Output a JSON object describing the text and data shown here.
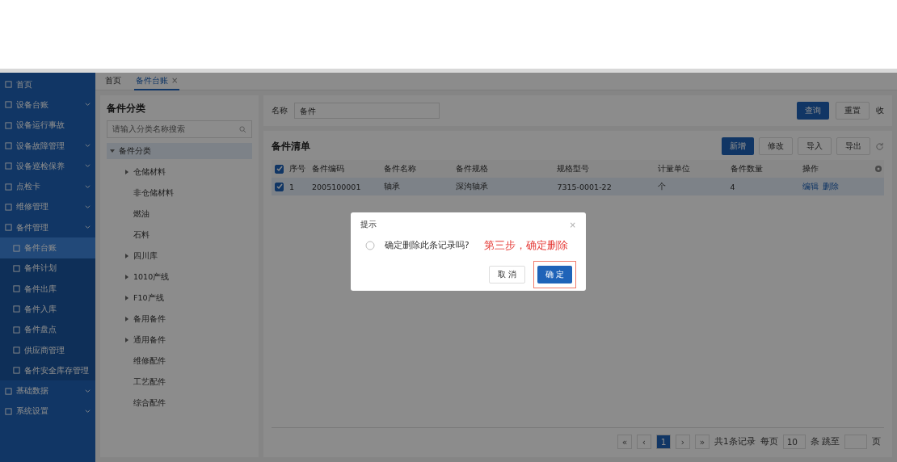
{
  "sidebar": {
    "items": [
      {
        "label": "首页",
        "expandable": false,
        "selected": false
      },
      {
        "label": "设备台账",
        "expandable": true,
        "selected": false
      },
      {
        "label": "设备运行事故",
        "expandable": false,
        "selected": false
      },
      {
        "label": "设备故障管理",
        "expandable": true,
        "selected": false
      },
      {
        "label": "设备巡检保养",
        "expandable": true,
        "selected": false
      },
      {
        "label": "点检卡",
        "expandable": true,
        "selected": false
      },
      {
        "label": "维修管理",
        "expandable": true,
        "selected": false
      },
      {
        "label": "备件管理",
        "expandable": true,
        "selected": false,
        "expanded": true,
        "children": [
          {
            "label": "备件台账",
            "selected": true
          },
          {
            "label": "备件计划",
            "selected": false
          },
          {
            "label": "备件出库",
            "selected": false
          },
          {
            "label": "备件入库",
            "selected": false
          },
          {
            "label": "备件盘点",
            "selected": false
          },
          {
            "label": "供应商管理",
            "selected": false
          },
          {
            "label": "备件安全库存管理",
            "selected": false
          }
        ]
      },
      {
        "label": "基础数据",
        "expandable": true,
        "selected": false
      },
      {
        "label": "系统设置",
        "expandable": true,
        "selected": false
      }
    ]
  },
  "tabs": [
    {
      "label": "首页",
      "selected": false
    },
    {
      "label": "备件台账",
      "selected": true,
      "close": "×"
    }
  ],
  "category_panel": {
    "title": "备件分类",
    "search": {
      "placeholder": "请输入分类名称搜索"
    },
    "tree": [
      {
        "label": "备件分类",
        "expandable": true,
        "expanded": true,
        "selected": true,
        "children": [
          {
            "label": "仓储材料",
            "expandable": true,
            "expanded": false,
            "selected": false
          },
          {
            "label": "非仓储材料",
            "expandable": false,
            "expanded": false,
            "selected": false
          },
          {
            "label": "燃油",
            "expandable": false,
            "expanded": false,
            "selected": false
          },
          {
            "label": "石料",
            "expandable": false,
            "expanded": false,
            "selected": false
          },
          {
            "label": "四川库",
            "expandable": true,
            "expanded": false,
            "selected": false
          },
          {
            "label": "1010产线",
            "expandable": true,
            "expanded": false,
            "selected": false
          },
          {
            "label": "F10产线",
            "expandable": true,
            "expanded": false,
            "selected": false
          },
          {
            "label": "备用备件",
            "expandable": true,
            "expanded": false,
            "selected": false
          },
          {
            "label": "通用备件",
            "expandable": true,
            "expanded": false,
            "selected": false
          },
          {
            "label": "维修配件",
            "expandable": false,
            "expanded": false,
            "selected": false
          },
          {
            "label": "工艺配件",
            "expandable": false,
            "expanded": false,
            "selected": false
          },
          {
            "label": "综合配件",
            "expandable": false,
            "expanded": false,
            "selected": false
          }
        ]
      }
    ]
  },
  "filter": {
    "label": "名称",
    "value": "备件",
    "buttons": [
      {
        "label": "查询",
        "primary": true
      },
      {
        "label": "重置",
        "primary": false
      }
    ],
    "collapse_label": "收"
  },
  "table": {
    "title": "备件清单",
    "buttons": [
      {
        "label": "新增",
        "primary": true
      },
      {
        "label": "修改",
        "primary": false
      },
      {
        "label": "导入",
        "primary": false
      },
      {
        "label": "导出",
        "primary": false
      }
    ],
    "all_checked": true,
    "columns": [
      "序号",
      "备件编码",
      "备件名称",
      "备件规格",
      "规格型号",
      "计量单位",
      "备件数量",
      "操作"
    ],
    "rows": [
      {
        "checked": true,
        "selected": true,
        "cells": [
          "1",
          "2005100001",
          "轴承",
          "深沟轴承",
          "7315-0001-22",
          "个",
          "4"
        ],
        "actions": [
          "编辑",
          "删除"
        ]
      }
    ]
  },
  "pagination": {
    "first": "«",
    "prev": "‹",
    "pages": [
      {
        "label": "1",
        "selected": true
      }
    ],
    "next": "›",
    "last": "»",
    "total": "共1条记录",
    "per_page_label": "每页",
    "per_page": "10",
    "jump_label": "条 跳至",
    "page_suffix": "页"
  },
  "dialog": {
    "title": "提示",
    "message": "确定删除此条记录吗?",
    "close": "×",
    "cancel": "取 消",
    "confirm": "确 定"
  },
  "annotation": {
    "text": "第三步，确定删除"
  }
}
